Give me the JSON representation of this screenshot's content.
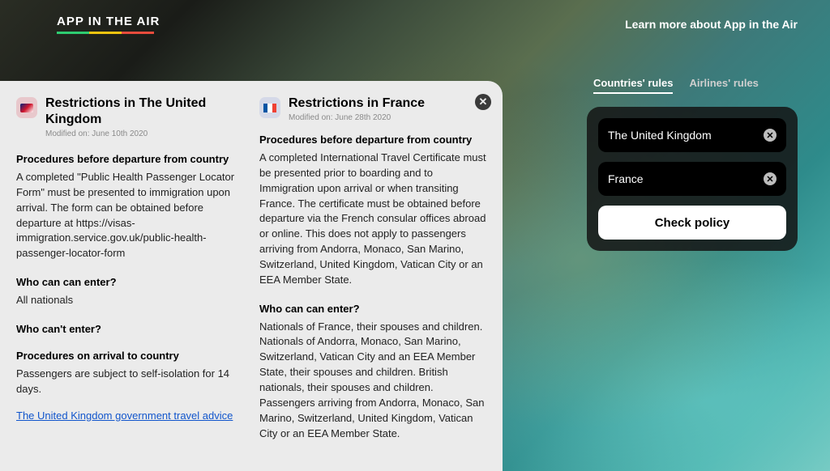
{
  "header": {
    "logo": "APP IN THE AIR",
    "learn_more": "Learn more about App in the Air"
  },
  "panel": {
    "close_icon": "✕",
    "columns": [
      {
        "flag": "uk",
        "title": "Restrictions in The United Kingdom",
        "modified": "Modified on: June 10th 2020",
        "sections": [
          {
            "heading": "Procedures before departure from country",
            "body": "A completed \"Public Health Passenger Locator Form\" must be presented to immigration upon arrival. The form can be obtained before departure at https://visas-immigration.service.gov.uk/public-health-passenger-locator-form"
          },
          {
            "heading": "Who can can enter?",
            "body": "All nationals"
          },
          {
            "heading": "Who can't enter?",
            "body": ""
          },
          {
            "heading": "Procedures on arrival to country",
            "body": "Passengers are subject to self-isolation for 14 days."
          }
        ],
        "link": "The United Kingdom government travel advice"
      },
      {
        "flag": "fr",
        "title": "Restrictions in France",
        "modified": "Modified on: June 28th 2020",
        "sections": [
          {
            "heading": "Procedures before departure from country",
            "body": "A completed International Travel Certificate must be presented prior to boarding and to Immigration upon arrival or when transiting France. The certificate must be obtained before departure via the French consular offices abroad or online. This does not apply to passengers arriving from Andorra, Monaco, San Marino, Switzerland, United Kingdom, Vatican City or an EEA Member State."
          },
          {
            "heading": "Who can can enter?",
            "body": "Nationals of France, their spouses and children. Nationals of Andorra, Monaco, San Marino, Switzerland, Vatican City and an EEA Member State, their spouses and children. British nationals, their spouses and children. Passengers arriving from Andorra, Monaco, San Marino, Switzerland, United Kingdom, Vatican City or an EEA Member State."
          }
        ]
      }
    ]
  },
  "right": {
    "tabs": {
      "countries": "Countries' rules",
      "airlines": "Airlines' rules"
    },
    "field1": "The United Kingdom",
    "field2": "France",
    "button": "Check policy"
  }
}
